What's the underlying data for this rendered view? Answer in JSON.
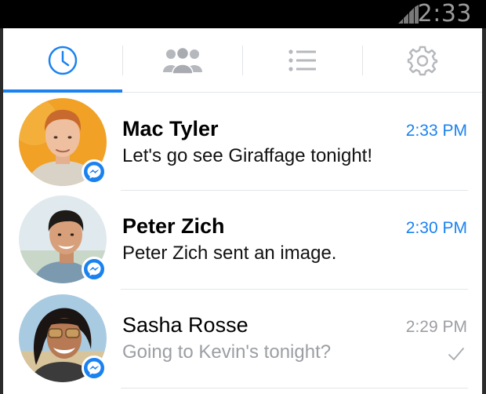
{
  "status_bar": {
    "time": "2:33",
    "signal_icon": "signal-icon"
  },
  "tabs": [
    {
      "name": "recent",
      "icon": "clock-icon",
      "active": true
    },
    {
      "name": "groups",
      "icon": "people-icon",
      "active": false
    },
    {
      "name": "people",
      "icon": "list-icon",
      "active": false
    },
    {
      "name": "settings",
      "icon": "gear-icon",
      "active": false
    }
  ],
  "colors": {
    "accent": "#1a82f0",
    "read_text": "#9b9ea3",
    "status_bar": "#000000"
  },
  "conversations": [
    {
      "name": "Mac Tyler",
      "preview": "Let's go see Giraffage tonight!",
      "time": "2:33 PM",
      "unread": true,
      "badge_icon": "messenger-icon"
    },
    {
      "name": "Peter Zich",
      "preview": "Peter Zich sent an image.",
      "time": "2:30 PM",
      "unread": true,
      "badge_icon": "messenger-icon"
    },
    {
      "name": "Sasha Rosse",
      "preview": "Going to Kevin's tonight?",
      "time": "2:29 PM",
      "unread": false,
      "badge_icon": "messenger-icon",
      "status_icon": "check-icon"
    }
  ]
}
